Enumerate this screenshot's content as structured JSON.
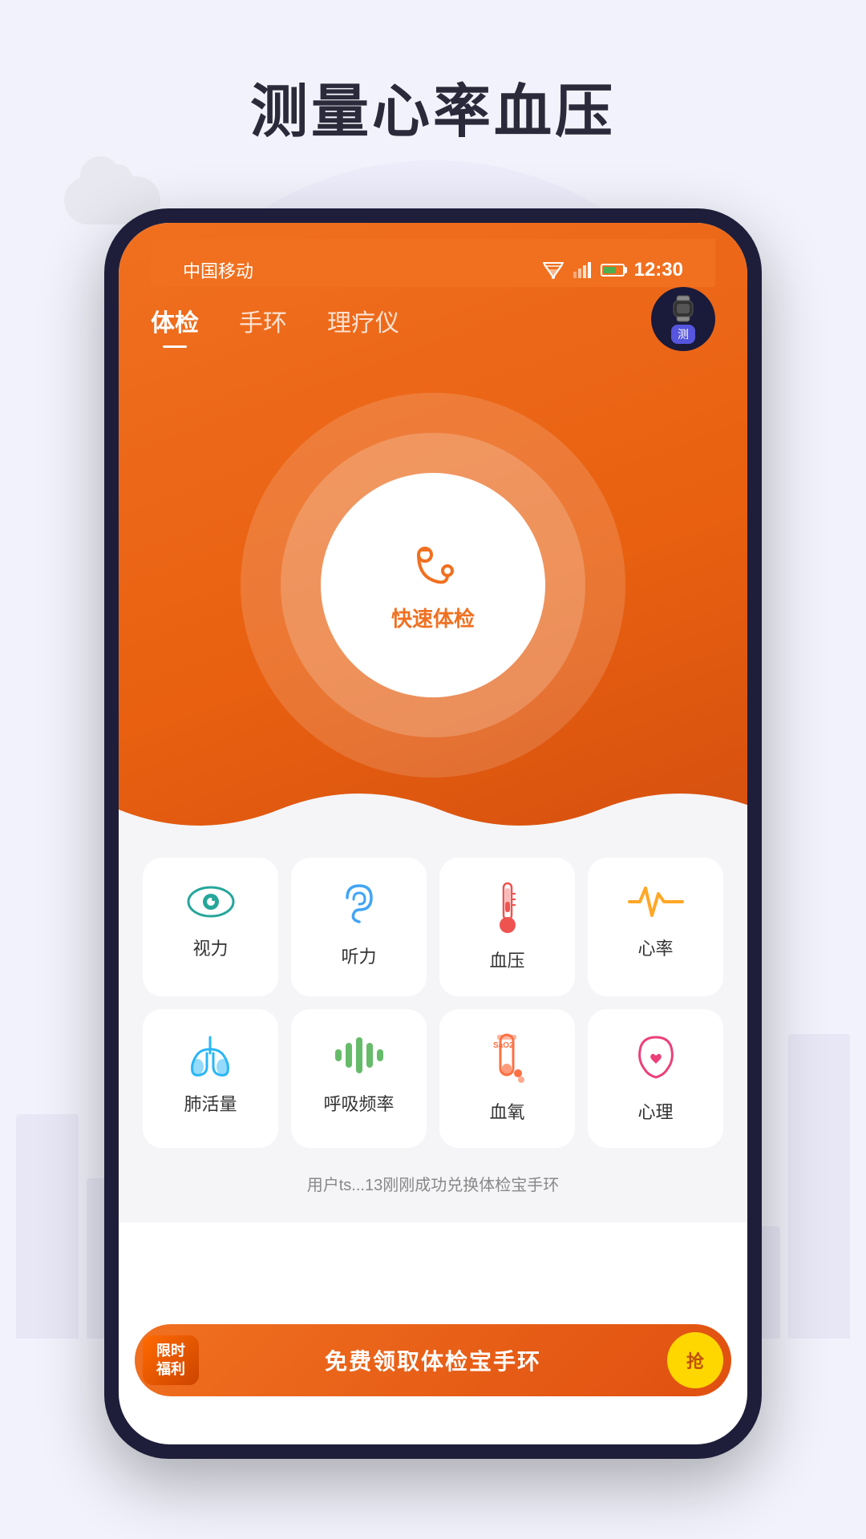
{
  "page": {
    "title": "测量心率血压",
    "background_color": "#f2f2fc"
  },
  "status_bar": {
    "carrier": "中国移动",
    "time": "12:30",
    "battery_pct": 70
  },
  "nav_tabs": [
    {
      "label": "体检",
      "active": true
    },
    {
      "label": "手环",
      "active": false
    },
    {
      "label": "理疗仪",
      "active": false
    }
  ],
  "quick_exam": {
    "label": "快速体检",
    "icon": "stethoscope"
  },
  "wristband_badge": {
    "label": "测"
  },
  "grid_items_row1": [
    {
      "id": "vision",
      "label": "视力",
      "icon": "eye"
    },
    {
      "id": "hearing",
      "label": "听力",
      "icon": "ear"
    },
    {
      "id": "bloodpressure",
      "label": "血压",
      "icon": "thermometer"
    },
    {
      "id": "heartrate",
      "label": "心率",
      "icon": "pulse"
    }
  ],
  "grid_items_row2": [
    {
      "id": "lung",
      "label": "肺活量",
      "icon": "lung"
    },
    {
      "id": "breath",
      "label": "呼吸频率",
      "icon": "breath"
    },
    {
      "id": "spo2",
      "label": "血氧",
      "icon": "sao2"
    },
    {
      "id": "mental",
      "label": "心理",
      "icon": "brain"
    }
  ],
  "notification": {
    "text": "用户ts...13刚刚成功兑换体检宝手环"
  },
  "bottom_banner": {
    "badge_line1": "限时",
    "badge_line2": "福利",
    "main_text": "免费领取体检宝手环",
    "button_label": "抢"
  }
}
